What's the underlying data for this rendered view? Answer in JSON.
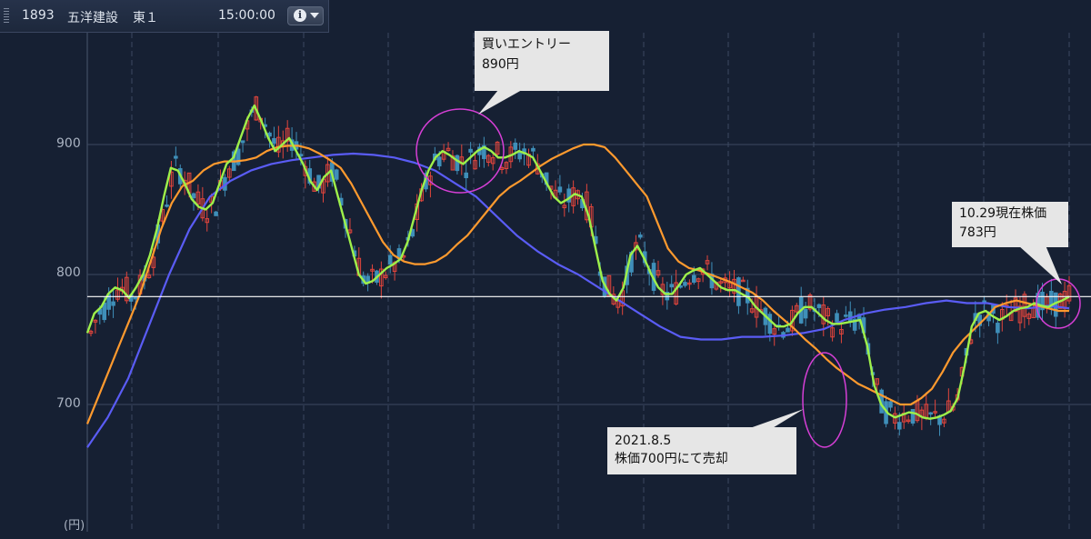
{
  "header": {
    "code": "1893",
    "name": "五洋建設",
    "market": "東１",
    "time": "15:00:00",
    "info_icon": "info-icon",
    "menu_icon": "chevron-down-icon"
  },
  "colors": {
    "background": "#162033",
    "grid": "#3c4860",
    "candle_up": "#e2453c",
    "candle_down": "#3f8fb9",
    "ma_short": "#9ef04a",
    "ma_mid": "#ff9a2e",
    "ma_long": "#5a5cf5",
    "price_line": "#ffffff",
    "highlight_circle": "#d63fd6"
  },
  "chart_data": {
    "type": "line",
    "title": "",
    "y_unit": "(円)",
    "y_ticks": [
      "700",
      "800",
      "900"
    ],
    "ylim": [
      597,
      995
    ],
    "x_count": 220,
    "grid": true,
    "series": [
      {
        "values": [
          755,
          770,
          775,
          785,
          790,
          788,
          782,
          790,
          800,
          815,
          835,
          860,
          882,
          880,
          870,
          858,
          852,
          850,
          855,
          870,
          885,
          890,
          905,
          920,
          930,
          918,
          905,
          895,
          900,
          905,
          895,
          885,
          872,
          865,
          875,
          880,
          860,
          840,
          820,
          800,
          793,
          795,
          800,
          805,
          808,
          812,
          825,
          845,
          865,
          880,
          890,
          895,
          892,
          888,
          885,
          890,
          895,
          898,
          895,
          890,
          890,
          892,
          895,
          893,
          890,
          880,
          870,
          860,
          855,
          858,
          862,
          860,
          845,
          820,
          795,
          785,
          780,
          790,
          815,
          822,
          812,
          800,
          790,
          785,
          785,
          792,
          800,
          803,
          805,
          800,
          795,
          790,
          788,
          788,
          785,
          782,
          775,
          770,
          765,
          760,
          760,
          762,
          770,
          775,
          775,
          770,
          765,
          762,
          762,
          763,
          764,
          765,
          745,
          715,
          700,
          693,
          690,
          692,
          694,
          693,
          690,
          689,
          690,
          692,
          695,
          705,
          730,
          760,
          770,
          772,
          768,
          765,
          768,
          772,
          774,
          775,
          778,
          776,
          775,
          778,
          780,
          783
        ]
      },
      {
        "values": [
          685,
          705,
          725,
          745,
          765,
          785,
          810,
          835,
          855,
          868,
          872,
          880,
          885,
          887,
          887,
          888,
          890,
          895,
          898,
          899,
          899,
          897,
          893,
          888,
          882,
          870,
          855,
          840,
          825,
          815,
          810,
          808,
          808,
          810,
          815,
          823,
          830,
          840,
          850,
          860,
          867,
          872,
          878,
          884,
          889,
          893,
          897,
          900,
          900,
          898,
          890,
          880,
          870,
          860,
          840,
          820,
          810,
          805,
          803,
          800,
          797,
          794,
          790,
          786,
          780,
          772,
          765,
          758,
          750,
          743,
          735,
          728,
          722,
          716,
          712,
          708,
          704,
          700,
          700,
          705,
          712,
          725,
          740,
          750,
          758,
          766,
          775,
          778,
          780,
          778,
          776,
          774,
          772,
          772
        ]
      },
      {
        "values": [
          667,
          690,
          720,
          760,
          800,
          835,
          860,
          872,
          880,
          885,
          888,
          890,
          892,
          893,
          892,
          890,
          886,
          880,
          870,
          860,
          845,
          830,
          818,
          808,
          800,
          790,
          780,
          770,
          760,
          752,
          750,
          750,
          752,
          752,
          753,
          755,
          758,
          765,
          770,
          773,
          775,
          778,
          780,
          778,
          778,
          775,
          774,
          776,
          774
        ]
      }
    ],
    "price_line_value": 783,
    "annotations": [
      {
        "text": "買いエントリー",
        "value": "890円"
      },
      {
        "text": "2021.8.5",
        "value": "株価700円にて売却"
      },
      {
        "text": "10.29現在株価",
        "value": "783円"
      }
    ]
  }
}
